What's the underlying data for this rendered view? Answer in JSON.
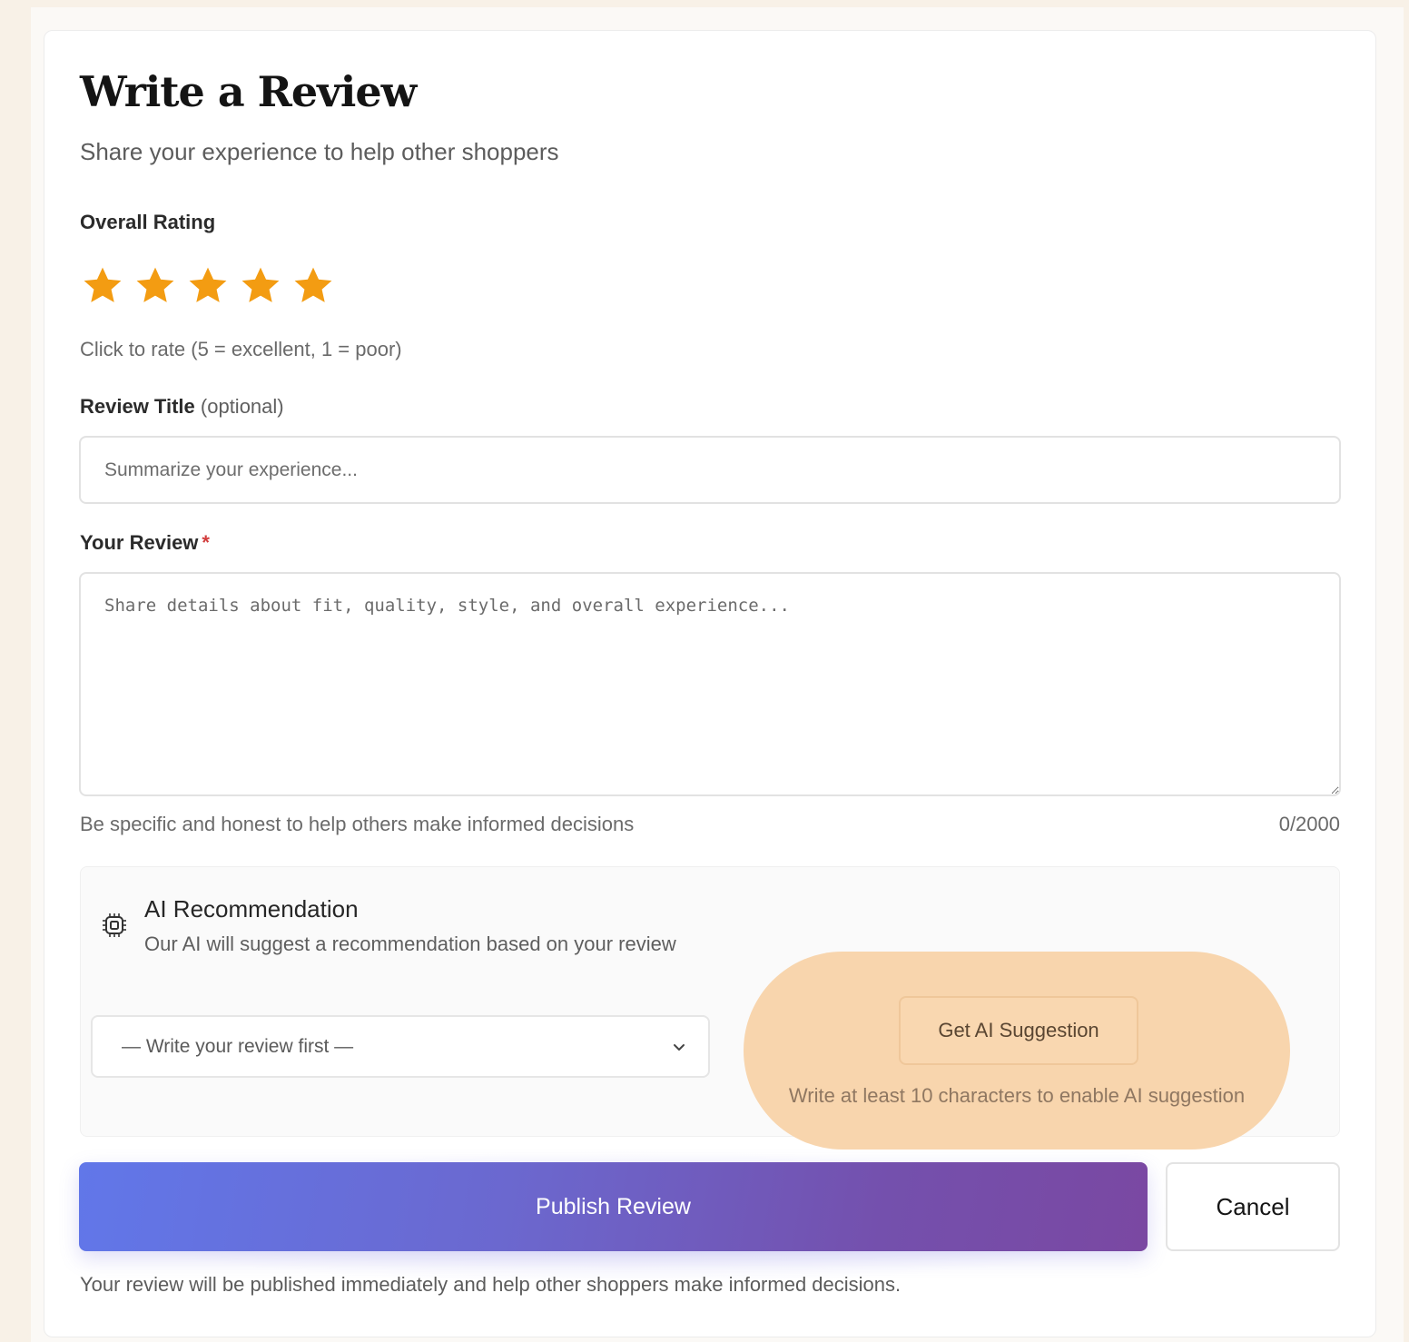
{
  "header": {
    "title": "Write a Review",
    "subtitle": "Share your experience to help other shoppers"
  },
  "rating": {
    "label": "Overall Rating",
    "value": 5,
    "max": 5,
    "star_color": "#f39c12",
    "hint": "Click to rate (5 = excellent, 1 = poor)"
  },
  "review_title": {
    "label": "Review Title",
    "optional_note": "(optional)",
    "value": "",
    "placeholder": "Summarize your experience..."
  },
  "review_body": {
    "label": "Your Review",
    "required_mark": "*",
    "value": "",
    "placeholder": "Share details about fit, quality, style, and overall experience...",
    "helper": "Be specific and honest to help others make informed decisions",
    "char_count": "0/2000"
  },
  "ai": {
    "icon": "chip-icon",
    "title": "AI Recommendation",
    "description": "Our AI will suggest a recommendation based on your review",
    "select_value": "— Write your review first —",
    "button_label": "Get AI Suggestion",
    "note": "Write at least 10 characters to enable AI suggestion",
    "highlight_color": "#f8d5ad"
  },
  "actions": {
    "publish_label": "Publish Review",
    "cancel_label": "Cancel",
    "publish_gradient": [
      "#6177e9",
      "#7a48a2"
    ]
  },
  "footer": {
    "note": "Your review will be published immediately and help other shoppers make informed decisions."
  }
}
